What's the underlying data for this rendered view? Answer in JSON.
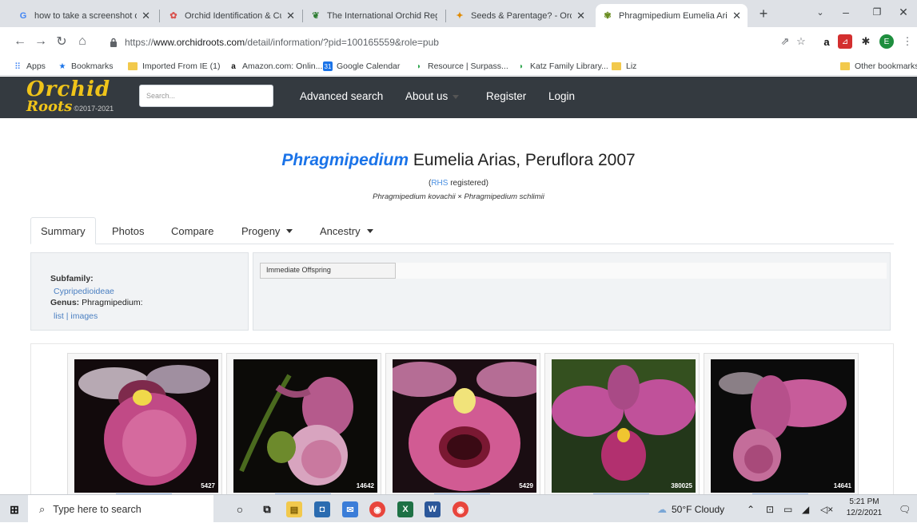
{
  "browser": {
    "tabs": [
      {
        "title": "how to take a screenshot on",
        "favicon": "G",
        "color": "#4285f4"
      },
      {
        "title": "Orchid Identification & Cultu",
        "favicon": "orchid-icon",
        "color": "#d9534f"
      },
      {
        "title": "The International Orchid Reg",
        "favicon": "rhs-icon",
        "color": "#2e7d32"
      },
      {
        "title": "Seeds & Parentage? - Orchic",
        "favicon": "person-icon",
        "color": "#e08a00"
      },
      {
        "title": "Phragmipedium Eumelia Aria",
        "favicon": "plant-icon",
        "color": "#6b8e23",
        "active": true
      }
    ],
    "url_scheme": "https://",
    "url_host": "www.orchidroots.com",
    "url_path": "/detail/information/?pid=100165559&role=pub",
    "bookmarks": [
      {
        "label": "Apps",
        "icon": "apps-grid-icon"
      },
      {
        "label": "Bookmarks",
        "icon": "star-icon"
      },
      {
        "label": "Imported From IE (1)",
        "icon": "folder-icon"
      },
      {
        "label": "Amazon.com: Onlin...",
        "icon": "amazon-icon"
      },
      {
        "label": "Google Calendar",
        "icon": "calendar-icon"
      },
      {
        "label": "Resource | Surpass...",
        "icon": "resource-icon"
      },
      {
        "label": "Katz Family Library...",
        "icon": "resource-icon"
      },
      {
        "label": "Liz",
        "icon": "folder-icon"
      }
    ],
    "other_bookmarks": "Other bookmarks",
    "profile_initial": "E"
  },
  "site": {
    "logo_line1": "Orchid",
    "logo_line2": "Roots",
    "logo_copyright": "©2017-2021",
    "search_placeholder": "Search...",
    "nav": [
      "Advanced search",
      "About us",
      "Register",
      "Login"
    ]
  },
  "plant": {
    "genus": "Phragmipedium",
    "name_rest": "Eumelia Arias, Peruflora 2007",
    "registry_link": "RHS",
    "registry_text": " registered)",
    "registry_open": "(",
    "parentage": "Phragmipedium kovachii × Phragmipedium schlimii"
  },
  "tabs": [
    "Summary",
    "Photos",
    "Compare",
    "Progeny",
    "Ancestry"
  ],
  "summary": {
    "subfamily_label": "Subfamily:",
    "subfamily_value": "Cypripedioideae",
    "genus_label": "Genus:",
    "genus_value": " Phragmipedium:",
    "link_list": "list",
    "link_sep": " | ",
    "link_images": "images",
    "offspring_button": "Immediate Offspring"
  },
  "gallery": [
    {
      "count": "5427"
    },
    {
      "count": "14642"
    },
    {
      "count": "5429"
    },
    {
      "count": "380025"
    },
    {
      "count": "14641"
    }
  ],
  "taskbar": {
    "search_placeholder": "Type here to search",
    "weather": "50°F Cloudy",
    "time": "5:21 PM",
    "date": "12/2/2021"
  }
}
